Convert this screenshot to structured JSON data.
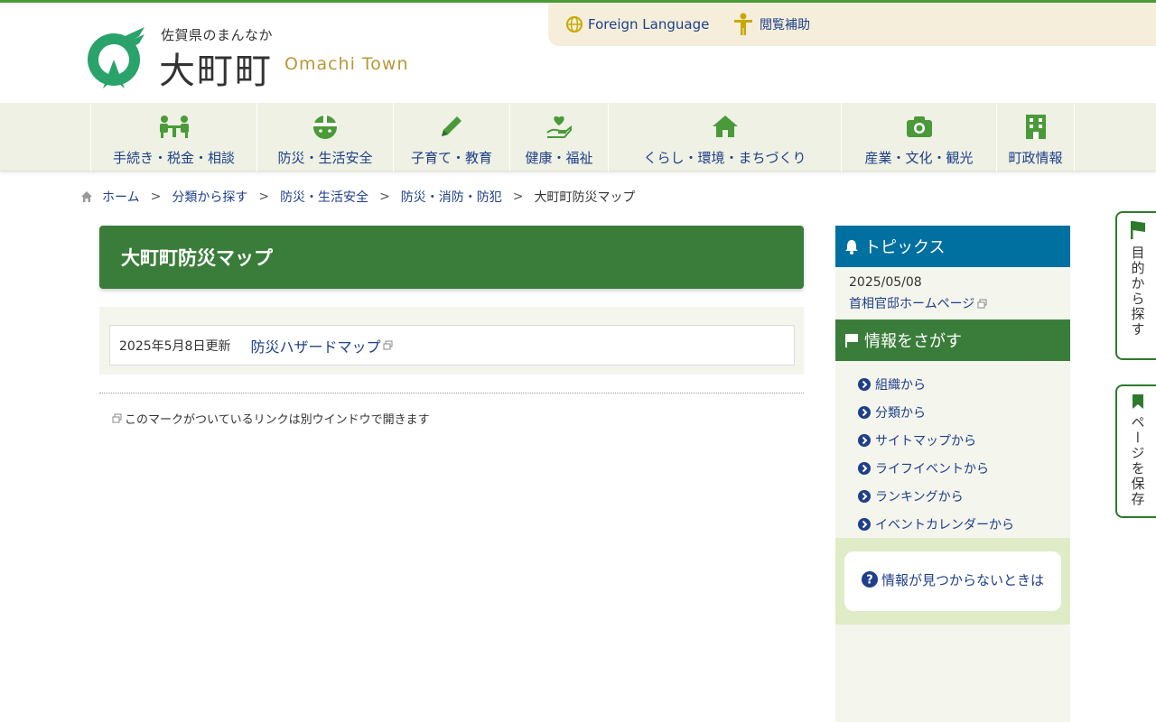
{
  "header": {
    "tagline": "佐賀県のまんなか",
    "town_name": "大町町",
    "town_roman": "Omachi Town",
    "foreign_language": "Foreign Language",
    "accessibility": "閲覧補助"
  },
  "nav": [
    {
      "label": "手続き・税金・相談",
      "icon": "people-table-icon"
    },
    {
      "label": "防災・生活安全",
      "icon": "helmet-icon"
    },
    {
      "label": "子育て・教育",
      "icon": "pencil-icon"
    },
    {
      "label": "健康・福祉",
      "icon": "heart-hand-icon"
    },
    {
      "label": "くらし・環境・まちづくり",
      "icon": "house-icon"
    },
    {
      "label": "産業・文化・観光",
      "icon": "camera-icon"
    },
    {
      "label": "町政情報",
      "icon": "building-icon"
    }
  ],
  "breadcrumb": {
    "home": "ホーム",
    "items": [
      "分類から探す",
      "防災・生活安全",
      "防災・消防・防犯"
    ],
    "current": "大町町防災マップ"
  },
  "main": {
    "title": "大町町防災マップ",
    "update_date": "2025年5月8日更新",
    "link": "防災ハザードマップ",
    "note": "このマークがついているリンクは別ウインドウで開きます"
  },
  "sidebar": {
    "topics_title": "トピックス",
    "topics_date": "2025/05/08",
    "topics_link": "首相官邸ホームページ",
    "search_title": "情報をさがす",
    "search_items": [
      "組織から",
      "分類から",
      "サイトマップから",
      "ライフイベントから",
      "ランキングから",
      "イベントカレンダーから"
    ],
    "notfound": "情報が見つからないときは"
  },
  "side_tabs": {
    "purpose": "目的から探す",
    "save": "ページを保存"
  },
  "colors": {
    "green": "#3a7d3a",
    "blue": "#0070a0",
    "link": "#1f3f8a",
    "gold": "#b8973a"
  }
}
